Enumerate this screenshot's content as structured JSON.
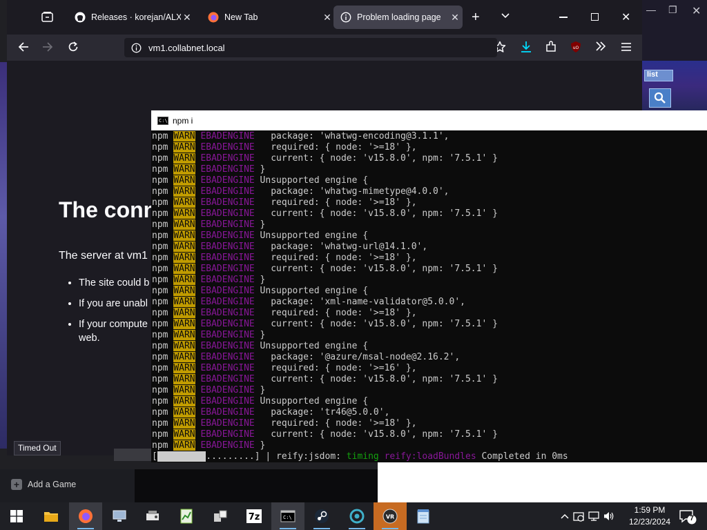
{
  "browser": {
    "tabs": [
      {
        "label": "Releases · korejan/ALXR-…",
        "icon": "github-icon",
        "active": false
      },
      {
        "label": "New Tab",
        "icon": "firefox-icon",
        "active": false
      },
      {
        "label": "Problem loading page",
        "icon": "info-icon",
        "active": true
      }
    ],
    "new_tab_label": "+",
    "url": "vm1.collabnet.local",
    "error": {
      "title": "The conn",
      "description": "The server at vm1",
      "bullets": [
        "The site could b",
        "If you are unabl",
        "If your compute",
        "web."
      ]
    },
    "status_tooltip": "Timed Out"
  },
  "console": {
    "title": "npm i",
    "lines": [
      {
        "prefix": "npm",
        "level": "WARN",
        "code": "EBADENGINE",
        "text": "   package: 'whatwg-encoding@3.1.1',"
      },
      {
        "prefix": "npm",
        "level": "WARN",
        "code": "EBADENGINE",
        "text": "   required: { node: '>=18' },"
      },
      {
        "prefix": "npm",
        "level": "WARN",
        "code": "EBADENGINE",
        "text": "   current: { node: 'v15.8.0', npm: '7.5.1' }"
      },
      {
        "prefix": "npm",
        "level": "WARN",
        "code": "EBADENGINE",
        "text": " }"
      },
      {
        "prefix": "npm",
        "level": "WARN",
        "code": "EBADENGINE",
        "text": " Unsupported engine {"
      },
      {
        "prefix": "npm",
        "level": "WARN",
        "code": "EBADENGINE",
        "text": "   package: 'whatwg-mimetype@4.0.0',"
      },
      {
        "prefix": "npm",
        "level": "WARN",
        "code": "EBADENGINE",
        "text": "   required: { node: '>=18' },"
      },
      {
        "prefix": "npm",
        "level": "WARN",
        "code": "EBADENGINE",
        "text": "   current: { node: 'v15.8.0', npm: '7.5.1' }"
      },
      {
        "prefix": "npm",
        "level": "WARN",
        "code": "EBADENGINE",
        "text": " }"
      },
      {
        "prefix": "npm",
        "level": "WARN",
        "code": "EBADENGINE",
        "text": " Unsupported engine {"
      },
      {
        "prefix": "npm",
        "level": "WARN",
        "code": "EBADENGINE",
        "text": "   package: 'whatwg-url@14.1.0',"
      },
      {
        "prefix": "npm",
        "level": "WARN",
        "code": "EBADENGINE",
        "text": "   required: { node: '>=18' },"
      },
      {
        "prefix": "npm",
        "level": "WARN",
        "code": "EBADENGINE",
        "text": "   current: { node: 'v15.8.0', npm: '7.5.1' }"
      },
      {
        "prefix": "npm",
        "level": "WARN",
        "code": "EBADENGINE",
        "text": " }"
      },
      {
        "prefix": "npm",
        "level": "WARN",
        "code": "EBADENGINE",
        "text": " Unsupported engine {"
      },
      {
        "prefix": "npm",
        "level": "WARN",
        "code": "EBADENGINE",
        "text": "   package: 'xml-name-validator@5.0.0',"
      },
      {
        "prefix": "npm",
        "level": "WARN",
        "code": "EBADENGINE",
        "text": "   required: { node: '>=18' },"
      },
      {
        "prefix": "npm",
        "level": "WARN",
        "code": "EBADENGINE",
        "text": "   current: { node: 'v15.8.0', npm: '7.5.1' }"
      },
      {
        "prefix": "npm",
        "level": "WARN",
        "code": "EBADENGINE",
        "text": " }"
      },
      {
        "prefix": "npm",
        "level": "WARN",
        "code": "EBADENGINE",
        "text": " Unsupported engine {"
      },
      {
        "prefix": "npm",
        "level": "WARN",
        "code": "EBADENGINE",
        "text": "   package: '@azure/msal-node@2.16.2',"
      },
      {
        "prefix": "npm",
        "level": "WARN",
        "code": "EBADENGINE",
        "text": "   required: { node: '>=16' },"
      },
      {
        "prefix": "npm",
        "level": "WARN",
        "code": "EBADENGINE",
        "text": "   current: { node: 'v15.8.0', npm: '7.5.1' }"
      },
      {
        "prefix": "npm",
        "level": "WARN",
        "code": "EBADENGINE",
        "text": " }"
      },
      {
        "prefix": "npm",
        "level": "WARN",
        "code": "EBADENGINE",
        "text": " Unsupported engine {"
      },
      {
        "prefix": "npm",
        "level": "WARN",
        "code": "EBADENGINE",
        "text": "   package: 'tr46@5.0.0',"
      },
      {
        "prefix": "npm",
        "level": "WARN",
        "code": "EBADENGINE",
        "text": "   required: { node: '>=18' },"
      },
      {
        "prefix": "npm",
        "level": "WARN",
        "code": "EBADENGINE",
        "text": "   current: { node: 'v15.8.0', npm: '7.5.1' }"
      },
      {
        "prefix": "npm",
        "level": "WARN",
        "code": "EBADENGINE",
        "text": " }"
      }
    ],
    "progress": {
      "open": "[",
      "dots": ".........]",
      "fill_fraction": 0.45,
      "sep": " | ",
      "stage": "reify:jsdom: ",
      "timing": "timing",
      "task": " reify:loadBundles",
      "done": " Completed in 0ms"
    }
  },
  "steam": {
    "add_game": "Add a Game",
    "list_button": "list"
  },
  "taskbar": {
    "time": "1:59 PM",
    "date": "12/23/2024",
    "notification_count": "7",
    "apps": [
      "start-icon",
      "file-explorer-icon",
      "firefox-icon",
      "remote-desktop-icon",
      "network-tool-icon",
      "spreadsheet-icon",
      "device-manager-icon",
      "7zip-icon",
      "terminal-icon",
      "steam-icon",
      "vpn-icon",
      "vr-icon",
      "notepad-icon"
    ]
  },
  "colors": {
    "warn_bg": "#c19c00",
    "ebadengine": "#881798",
    "timing_green": "#13a10e",
    "firefox_download_blue": "#00ddff"
  }
}
